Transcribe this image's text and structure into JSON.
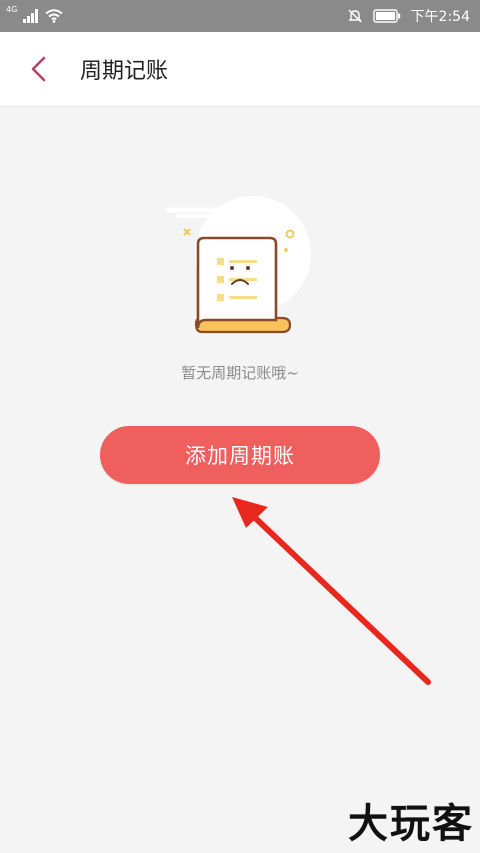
{
  "status_bar": {
    "network": "4G",
    "time": "下午2:54"
  },
  "header": {
    "title": "周期记账"
  },
  "empty_state": {
    "message": "暂无周期记账哦~"
  },
  "actions": {
    "add_label": "添加周期账"
  },
  "watermark": "大玩客",
  "colors": {
    "accent": "#ee5f5d",
    "back_icon": "#b0456a",
    "status_bar": "#8a8a8a",
    "arrow": "#e8281e"
  }
}
